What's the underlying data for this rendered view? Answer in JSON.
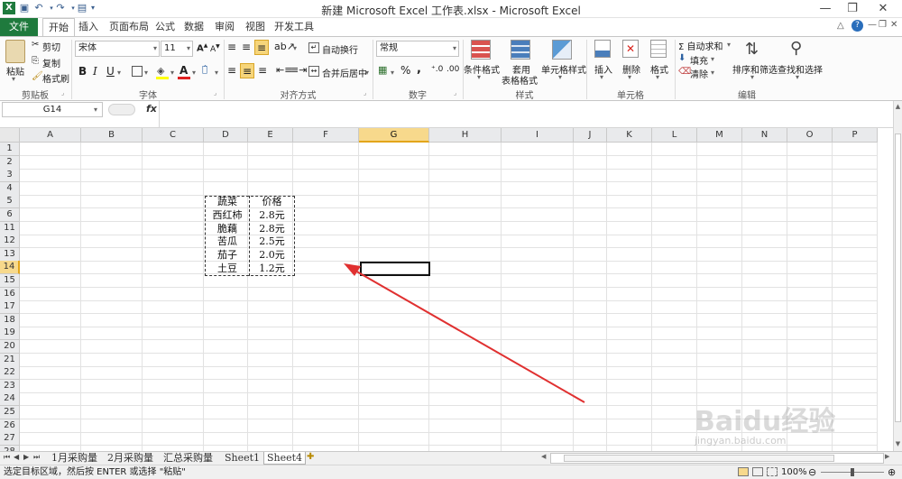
{
  "titlebar": {
    "title": "新建 Microsoft Excel 工作表.xlsx - Microsoft Excel"
  },
  "tabs": [
    "文件",
    "开始",
    "插入",
    "页面布局",
    "公式",
    "数据",
    "审阅",
    "视图",
    "开发工具"
  ],
  "ribbon": {
    "clipboard": {
      "paste": "粘贴",
      "cut": "剪切",
      "copy": "复制",
      "format_painter": "格式刷",
      "label": "剪贴板"
    },
    "font": {
      "name": "宋体",
      "size": "11",
      "bold": "B",
      "italic": "I",
      "underline": "U",
      "font_color_letter": "A",
      "label": "字体"
    },
    "alignment": {
      "wrap": "自动换行",
      "merge": "合并后居中",
      "label": "对齐方式"
    },
    "number": {
      "format": "常规",
      "percent": "%",
      "comma": ",",
      "label": "数字"
    },
    "styles": {
      "conditional": "条件格式",
      "table1": "套用",
      "table2": "表格格式",
      "cell_styles": "单元格样式",
      "label": "样式"
    },
    "cells": {
      "insert": "插入",
      "delete": "删除",
      "format": "格式",
      "label": "单元格"
    },
    "editing": {
      "autosum": "Σ 自动求和",
      "fill": "填充",
      "clear": "清除",
      "sort": "排序和筛选",
      "find": "查找和选择",
      "label": "编辑"
    }
  },
  "formula_bar": {
    "name_box": "G14",
    "fx": "fx",
    "value": ""
  },
  "grid": {
    "columns": [
      "A",
      "B",
      "C",
      "D",
      "E",
      "F",
      "G",
      "H",
      "I",
      "J",
      "K",
      "L",
      "M",
      "N",
      "O",
      "P"
    ],
    "rows": [
      "1",
      "2",
      "3",
      "4",
      "5",
      "6",
      "11",
      "12",
      "13",
      "14",
      "15",
      "16",
      "17",
      "18",
      "19",
      "20",
      "21",
      "22",
      "23",
      "24",
      "25",
      "26",
      "27",
      "28",
      "29"
    ],
    "selected_cell": "G14",
    "table": {
      "header": [
        "蔬菜",
        "价格"
      ],
      "rows": [
        [
          "西红柿",
          "2.8元"
        ],
        [
          "脆藕",
          "2.8元"
        ],
        [
          "苦瓜",
          "2.5元"
        ],
        [
          "茄子",
          "2.0元"
        ],
        [
          "土豆",
          "1.2元"
        ]
      ]
    }
  },
  "sheets": [
    "1月采购量",
    "2月采购量",
    "汇总采购量",
    "Sheet1",
    "Sheet4"
  ],
  "active_sheet": "Sheet4",
  "status": {
    "message": "选定目标区域，然后按 ENTER 或选择 \"粘贴\"",
    "zoom": "100%"
  },
  "watermark": {
    "text": "Baidu经验",
    "url": "jingyan.baidu.com"
  },
  "colors": {
    "excel_green": "#1f7a3d",
    "arrow_red": "#e03030",
    "selected_header": "#f7d98c"
  }
}
